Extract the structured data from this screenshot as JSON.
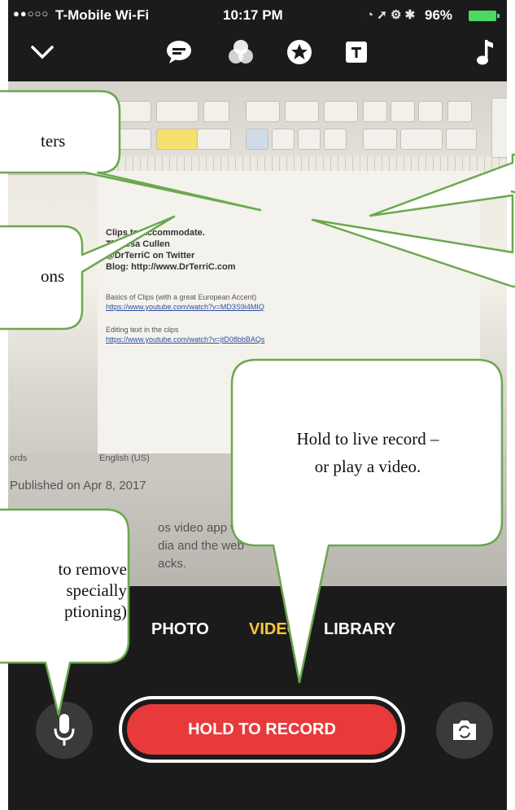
{
  "status_bar": {
    "signal": "●●○○○",
    "carrier": "T-Mobile Wi-Fi",
    "time": "10:17 PM",
    "battery": "96%"
  },
  "toolbar": {
    "icons": [
      "chevron-down-icon",
      "speech-bubble-icon",
      "filters-icon",
      "star-icon",
      "title-card-icon",
      "music-note-icon"
    ]
  },
  "document": {
    "lines": [
      "Clips to Accommodate.",
      "Theresa Cullen",
      "@DrTerriC on Twitter",
      "Blog: http://www.DrTerriC.com"
    ],
    "basics_label": "Basics of Clips (with a great European Accent)",
    "basics_link": "https://www.youtube.com/watch?v=MD3S9i4MIQ",
    "editing_label": "Editing text in the clips",
    "editing_link": "https://www.youtube.com/watch?v=jtD08bbBAQs",
    "status_words": "ords",
    "status_lang": "English (US)",
    "behind_1": "Published on Apr 8, 2017",
    "behind_2": "os video app with",
    "behind_3": "dia and the web",
    "behind_4": "acks."
  },
  "modes": {
    "photo": "PHOTO",
    "video": "VIDEO",
    "library": "LIBRARY"
  },
  "record_button": {
    "label": "HOLD TO RECORD"
  },
  "callouts": {
    "filters": "ters",
    "buttons": "ons",
    "record": [
      "Hold to live record –",
      "or play a video."
    ],
    "mic": [
      "to remove",
      "specially",
      "ptioning)"
    ]
  },
  "colors": {
    "record_red": "#e83a3a",
    "active_mode": "#f7c83b",
    "battery_green": "#4cd964",
    "callout_border": "#6aa84f"
  }
}
